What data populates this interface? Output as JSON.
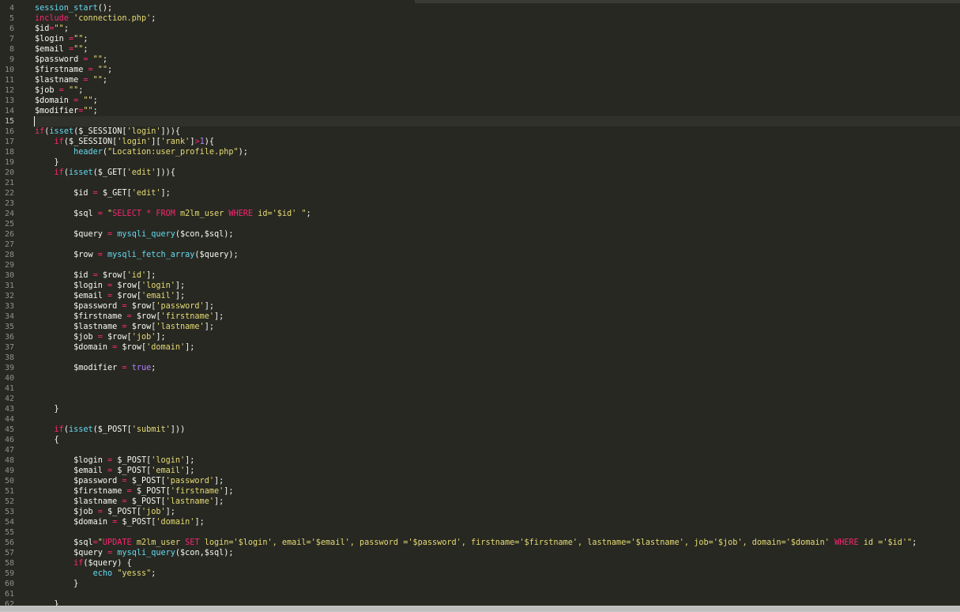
{
  "editor": {
    "current_line": 15,
    "code_lines": [
      {
        "no": "4",
        "tokens": [
          {
            "t": "session_start",
            "c": "f"
          },
          {
            "t": "();",
            "c": "v"
          }
        ]
      },
      {
        "no": "5",
        "tokens": [
          {
            "t": "include ",
            "c": "k"
          },
          {
            "t": "'connection.php'",
            "c": "s"
          },
          {
            "t": ";",
            "c": "v"
          }
        ]
      },
      {
        "no": "6",
        "tokens": [
          {
            "t": "$id",
            "c": "v"
          },
          {
            "t": "=",
            "c": "k"
          },
          {
            "t": "\"\"",
            "c": "s"
          },
          {
            "t": ";",
            "c": "v"
          }
        ]
      },
      {
        "no": "7",
        "tokens": [
          {
            "t": "$login ",
            "c": "v"
          },
          {
            "t": "=",
            "c": "k"
          },
          {
            "t": "\"\"",
            "c": "s"
          },
          {
            "t": ";",
            "c": "v"
          }
        ]
      },
      {
        "no": "8",
        "tokens": [
          {
            "t": "$email ",
            "c": "v"
          },
          {
            "t": "=",
            "c": "k"
          },
          {
            "t": "\"\"",
            "c": "s"
          },
          {
            "t": ";",
            "c": "v"
          }
        ]
      },
      {
        "no": "9",
        "tokens": [
          {
            "t": "$password ",
            "c": "v"
          },
          {
            "t": "= ",
            "c": "k"
          },
          {
            "t": "\"\"",
            "c": "s"
          },
          {
            "t": ";",
            "c": "v"
          }
        ]
      },
      {
        "no": "10",
        "tokens": [
          {
            "t": "$firstname ",
            "c": "v"
          },
          {
            "t": "= ",
            "c": "k"
          },
          {
            "t": "\"\"",
            "c": "s"
          },
          {
            "t": ";",
            "c": "v"
          }
        ]
      },
      {
        "no": "11",
        "tokens": [
          {
            "t": "$lastname ",
            "c": "v"
          },
          {
            "t": "= ",
            "c": "k"
          },
          {
            "t": "\"\"",
            "c": "s"
          },
          {
            "t": ";",
            "c": "v"
          }
        ]
      },
      {
        "no": "12",
        "tokens": [
          {
            "t": "$job ",
            "c": "v"
          },
          {
            "t": "= ",
            "c": "k"
          },
          {
            "t": "\"\"",
            "c": "s"
          },
          {
            "t": ";",
            "c": "v"
          }
        ]
      },
      {
        "no": "13",
        "tokens": [
          {
            "t": "$domain ",
            "c": "v"
          },
          {
            "t": "= ",
            "c": "k"
          },
          {
            "t": "\"\"",
            "c": "s"
          },
          {
            "t": ";",
            "c": "v"
          }
        ]
      },
      {
        "no": "14",
        "tokens": [
          {
            "t": "$modifier",
            "c": "v"
          },
          {
            "t": "=",
            "c": "k"
          },
          {
            "t": "\"\"",
            "c": "s"
          },
          {
            "t": ";",
            "c": "v"
          }
        ]
      },
      {
        "no": "15",
        "tokens": []
      },
      {
        "no": "16",
        "tokens": [
          {
            "t": "if",
            "c": "k"
          },
          {
            "t": "(",
            "c": "v"
          },
          {
            "t": "isset",
            "c": "f"
          },
          {
            "t": "($_SESSION[",
            "c": "v"
          },
          {
            "t": "'login'",
            "c": "s"
          },
          {
            "t": "])){",
            "c": "v"
          }
        ]
      },
      {
        "no": "17",
        "tokens": [
          {
            "t": "    ",
            "c": "v"
          },
          {
            "t": "if",
            "c": "k"
          },
          {
            "t": "($_SESSION[",
            "c": "v"
          },
          {
            "t": "'login'",
            "c": "s"
          },
          {
            "t": "][",
            "c": "v"
          },
          {
            "t": "'rank'",
            "c": "s"
          },
          {
            "t": "]",
            "c": "v"
          },
          {
            "t": ">",
            "c": "k"
          },
          {
            "t": "1",
            "c": "n"
          },
          {
            "t": "){",
            "c": "v"
          }
        ]
      },
      {
        "no": "18",
        "tokens": [
          {
            "t": "        ",
            "c": "v"
          },
          {
            "t": "header",
            "c": "f"
          },
          {
            "t": "(",
            "c": "v"
          },
          {
            "t": "\"Location:user_profile.php\"",
            "c": "s"
          },
          {
            "t": ");",
            "c": "v"
          }
        ]
      },
      {
        "no": "19",
        "tokens": [
          {
            "t": "    }",
            "c": "v"
          }
        ]
      },
      {
        "no": "20",
        "tokens": [
          {
            "t": "    ",
            "c": "v"
          },
          {
            "t": "if",
            "c": "k"
          },
          {
            "t": "(",
            "c": "v"
          },
          {
            "t": "isset",
            "c": "f"
          },
          {
            "t": "($_GET[",
            "c": "v"
          },
          {
            "t": "'edit'",
            "c": "s"
          },
          {
            "t": "])){",
            "c": "v"
          }
        ]
      },
      {
        "no": "21",
        "tokens": []
      },
      {
        "no": "22",
        "tokens": [
          {
            "t": "        $id ",
            "c": "v"
          },
          {
            "t": "= ",
            "c": "k"
          },
          {
            "t": "$_GET[",
            "c": "v"
          },
          {
            "t": "'edit'",
            "c": "s"
          },
          {
            "t": "];",
            "c": "v"
          }
        ]
      },
      {
        "no": "23",
        "tokens": []
      },
      {
        "no": "24",
        "tokens": [
          {
            "t": "        $sql ",
            "c": "v"
          },
          {
            "t": "= ",
            "c": "k"
          },
          {
            "t": "\"",
            "c": "s"
          },
          {
            "t": "SELECT * FROM ",
            "c": "k"
          },
          {
            "t": "m2lm_user ",
            "c": "s"
          },
          {
            "t": "WHERE ",
            "c": "k"
          },
          {
            "t": "id='$id' \"",
            "c": "s"
          },
          {
            "t": ";",
            "c": "v"
          }
        ]
      },
      {
        "no": "25",
        "tokens": []
      },
      {
        "no": "26",
        "tokens": [
          {
            "t": "        $query ",
            "c": "v"
          },
          {
            "t": "= ",
            "c": "k"
          },
          {
            "t": "mysqli_query",
            "c": "f"
          },
          {
            "t": "($con,$sql);",
            "c": "v"
          }
        ]
      },
      {
        "no": "27",
        "tokens": []
      },
      {
        "no": "28",
        "tokens": [
          {
            "t": "        $row ",
            "c": "v"
          },
          {
            "t": "= ",
            "c": "k"
          },
          {
            "t": "mysqli_fetch_array",
            "c": "f"
          },
          {
            "t": "($query);",
            "c": "v"
          }
        ]
      },
      {
        "no": "29",
        "tokens": []
      },
      {
        "no": "30",
        "tokens": [
          {
            "t": "        $id ",
            "c": "v"
          },
          {
            "t": "= ",
            "c": "k"
          },
          {
            "t": "$row[",
            "c": "v"
          },
          {
            "t": "'id'",
            "c": "s"
          },
          {
            "t": "];",
            "c": "v"
          }
        ]
      },
      {
        "no": "31",
        "tokens": [
          {
            "t": "        $login ",
            "c": "v"
          },
          {
            "t": "= ",
            "c": "k"
          },
          {
            "t": "$row[",
            "c": "v"
          },
          {
            "t": "'login'",
            "c": "s"
          },
          {
            "t": "];",
            "c": "v"
          }
        ]
      },
      {
        "no": "32",
        "tokens": [
          {
            "t": "        $email ",
            "c": "v"
          },
          {
            "t": "= ",
            "c": "k"
          },
          {
            "t": "$row[",
            "c": "v"
          },
          {
            "t": "'email'",
            "c": "s"
          },
          {
            "t": "];",
            "c": "v"
          }
        ]
      },
      {
        "no": "33",
        "tokens": [
          {
            "t": "        $password ",
            "c": "v"
          },
          {
            "t": "= ",
            "c": "k"
          },
          {
            "t": "$row[",
            "c": "v"
          },
          {
            "t": "'password'",
            "c": "s"
          },
          {
            "t": "];",
            "c": "v"
          }
        ]
      },
      {
        "no": "34",
        "tokens": [
          {
            "t": "        $firstname ",
            "c": "v"
          },
          {
            "t": "= ",
            "c": "k"
          },
          {
            "t": "$row[",
            "c": "v"
          },
          {
            "t": "'firstname'",
            "c": "s"
          },
          {
            "t": "];",
            "c": "v"
          }
        ]
      },
      {
        "no": "35",
        "tokens": [
          {
            "t": "        $lastname ",
            "c": "v"
          },
          {
            "t": "= ",
            "c": "k"
          },
          {
            "t": "$row[",
            "c": "v"
          },
          {
            "t": "'lastname'",
            "c": "s"
          },
          {
            "t": "];",
            "c": "v"
          }
        ]
      },
      {
        "no": "36",
        "tokens": [
          {
            "t": "        $job ",
            "c": "v"
          },
          {
            "t": "= ",
            "c": "k"
          },
          {
            "t": "$row[",
            "c": "v"
          },
          {
            "t": "'job'",
            "c": "s"
          },
          {
            "t": "];",
            "c": "v"
          }
        ]
      },
      {
        "no": "37",
        "tokens": [
          {
            "t": "        $domain ",
            "c": "v"
          },
          {
            "t": "= ",
            "c": "k"
          },
          {
            "t": "$row[",
            "c": "v"
          },
          {
            "t": "'domain'",
            "c": "s"
          },
          {
            "t": "];",
            "c": "v"
          }
        ]
      },
      {
        "no": "38",
        "tokens": []
      },
      {
        "no": "39",
        "tokens": [
          {
            "t": "        $modifier ",
            "c": "v"
          },
          {
            "t": "= ",
            "c": "k"
          },
          {
            "t": "true",
            "c": "n"
          },
          {
            "t": ";",
            "c": "v"
          }
        ]
      },
      {
        "no": "40",
        "tokens": []
      },
      {
        "no": "41",
        "tokens": []
      },
      {
        "no": "42",
        "tokens": []
      },
      {
        "no": "43",
        "tokens": [
          {
            "t": "    }",
            "c": "v"
          }
        ]
      },
      {
        "no": "44",
        "tokens": []
      },
      {
        "no": "45",
        "tokens": [
          {
            "t": "    ",
            "c": "v"
          },
          {
            "t": "if",
            "c": "k"
          },
          {
            "t": "(",
            "c": "v"
          },
          {
            "t": "isset",
            "c": "f"
          },
          {
            "t": "($_POST[",
            "c": "v"
          },
          {
            "t": "'submit'",
            "c": "s"
          },
          {
            "t": "]))",
            "c": "v"
          }
        ]
      },
      {
        "no": "46",
        "tokens": [
          {
            "t": "    {",
            "c": "v"
          }
        ]
      },
      {
        "no": "47",
        "tokens": []
      },
      {
        "no": "48",
        "tokens": [
          {
            "t": "        $login ",
            "c": "v"
          },
          {
            "t": "= ",
            "c": "k"
          },
          {
            "t": "$_POST[",
            "c": "v"
          },
          {
            "t": "'login'",
            "c": "s"
          },
          {
            "t": "];",
            "c": "v"
          }
        ]
      },
      {
        "no": "49",
        "tokens": [
          {
            "t": "        $email ",
            "c": "v"
          },
          {
            "t": "= ",
            "c": "k"
          },
          {
            "t": "$_POST[",
            "c": "v"
          },
          {
            "t": "'email'",
            "c": "s"
          },
          {
            "t": "];",
            "c": "v"
          }
        ]
      },
      {
        "no": "50",
        "tokens": [
          {
            "t": "        $password ",
            "c": "v"
          },
          {
            "t": "= ",
            "c": "k"
          },
          {
            "t": "$_POST[",
            "c": "v"
          },
          {
            "t": "'password'",
            "c": "s"
          },
          {
            "t": "];",
            "c": "v"
          }
        ]
      },
      {
        "no": "51",
        "tokens": [
          {
            "t": "        $firstname ",
            "c": "v"
          },
          {
            "t": "= ",
            "c": "k"
          },
          {
            "t": "$_POST[",
            "c": "v"
          },
          {
            "t": "'firstname'",
            "c": "s"
          },
          {
            "t": "];",
            "c": "v"
          }
        ]
      },
      {
        "no": "52",
        "tokens": [
          {
            "t": "        $lastname ",
            "c": "v"
          },
          {
            "t": "= ",
            "c": "k"
          },
          {
            "t": "$_POST[",
            "c": "v"
          },
          {
            "t": "'lastname'",
            "c": "s"
          },
          {
            "t": "];",
            "c": "v"
          }
        ]
      },
      {
        "no": "53",
        "tokens": [
          {
            "t": "        $job ",
            "c": "v"
          },
          {
            "t": "= ",
            "c": "k"
          },
          {
            "t": "$_POST[",
            "c": "v"
          },
          {
            "t": "'job'",
            "c": "s"
          },
          {
            "t": "];",
            "c": "v"
          }
        ]
      },
      {
        "no": "54",
        "tokens": [
          {
            "t": "        $domain ",
            "c": "v"
          },
          {
            "t": "= ",
            "c": "k"
          },
          {
            "t": "$_POST[",
            "c": "v"
          },
          {
            "t": "'domain'",
            "c": "s"
          },
          {
            "t": "];",
            "c": "v"
          }
        ]
      },
      {
        "no": "55",
        "tokens": []
      },
      {
        "no": "56",
        "tokens": [
          {
            "t": "        $sql",
            "c": "v"
          },
          {
            "t": "=",
            "c": "k"
          },
          {
            "t": "\"",
            "c": "s"
          },
          {
            "t": "UPDATE ",
            "c": "k"
          },
          {
            "t": "m2lm_user ",
            "c": "s"
          },
          {
            "t": "SET ",
            "c": "k"
          },
          {
            "t": "login='$login', email='$email', password ='$password', firstname='$firstname', lastname='$lastname', job='$job', domain='$domain' ",
            "c": "s"
          },
          {
            "t": "WHERE ",
            "c": "k"
          },
          {
            "t": "id ='$id'\"",
            "c": "s"
          },
          {
            "t": ";",
            "c": "v"
          }
        ]
      },
      {
        "no": "57",
        "tokens": [
          {
            "t": "        $query ",
            "c": "v"
          },
          {
            "t": "= ",
            "c": "k"
          },
          {
            "t": "mysqli_query",
            "c": "f"
          },
          {
            "t": "($con,$sql);",
            "c": "v"
          }
        ]
      },
      {
        "no": "58",
        "tokens": [
          {
            "t": "        ",
            "c": "v"
          },
          {
            "t": "if",
            "c": "k"
          },
          {
            "t": "($query) {",
            "c": "v"
          }
        ]
      },
      {
        "no": "59",
        "tokens": [
          {
            "t": "            ",
            "c": "v"
          },
          {
            "t": "echo ",
            "c": "f"
          },
          {
            "t": "\"yesss\"",
            "c": "s"
          },
          {
            "t": ";",
            "c": "v"
          }
        ]
      },
      {
        "no": "60",
        "tokens": [
          {
            "t": "        }",
            "c": "v"
          }
        ]
      },
      {
        "no": "61",
        "tokens": []
      },
      {
        "no": "62",
        "tokens": [
          {
            "t": "    }",
            "c": "v"
          }
        ]
      }
    ]
  },
  "theme": {
    "background": "#272822",
    "keyword": "#f92672",
    "string": "#e6db74",
    "function": "#66d9ef",
    "number": "#ae81ff",
    "plain": "#f8f8f2",
    "gutter_text": "#8f908a"
  }
}
